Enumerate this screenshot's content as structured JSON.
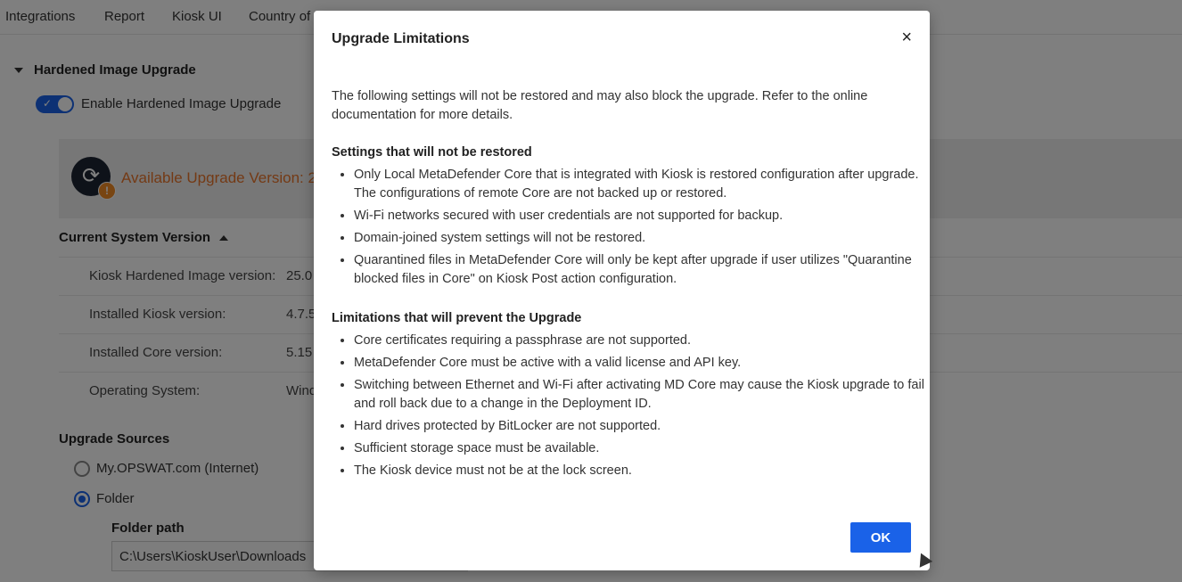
{
  "tabs": [
    "Integrations",
    "Report",
    "Kiosk UI",
    "Country of"
  ],
  "hardened": {
    "title": "Hardened Image Upgrade",
    "enable_label": "Enable Hardened Image Upgrade",
    "available_text": "Available Upgrade Version: 2"
  },
  "current": {
    "title": "Current System Version",
    "rows": [
      {
        "label": "Kiosk Hardened Image version:",
        "value": "25.0"
      },
      {
        "label": "Installed Kiosk version:",
        "value": "4.7.5"
      },
      {
        "label": "Installed Core version:",
        "value": "5.15"
      },
      {
        "label": "Operating System:",
        "value": "Wind"
      }
    ]
  },
  "sources": {
    "title": "Upgrade Sources",
    "options": [
      {
        "label": "My.OPSWAT.com (Internet)",
        "selected": false
      },
      {
        "label": "Folder",
        "selected": true
      }
    ],
    "folder_path_label": "Folder path",
    "folder_path_value": "C:\\Users\\KioskUser\\Downloads"
  },
  "modal": {
    "title": "Upgrade Limitations",
    "close_icon": "×",
    "intro": "The following settings will not be restored and may also block the upgrade. Refer to the online documentation for more details.",
    "section1_title": "Settings that will not be restored",
    "section1_items": [
      "Only Local MetaDefender Core that is integrated with Kiosk is restored configuration after upgrade. The configurations of remote Core are not backed up or restored.",
      "Wi-Fi networks secured with user credentials are not supported for backup.",
      "Domain-joined system settings will not be restored.",
      "Quarantined files in MetaDefender Core will only be kept after upgrade if user utilizes \"Quarantine blocked files in Core\" on Kiosk Post action configuration."
    ],
    "section2_title": "Limitations that will prevent the Upgrade",
    "section2_items": [
      "Core certificates requiring a passphrase are not supported.",
      "MetaDefender Core must be active with a valid license and API key.",
      "Switching between Ethernet and Wi-Fi after activating MD Core may cause the Kiosk upgrade to fail and roll back due to a change in the Deployment ID.",
      "Hard drives protected by BitLocker are not supported.",
      "Sufficient storage space must be available.",
      "The Kiosk device must not be at the lock screen."
    ],
    "ok_label": "OK"
  },
  "colors": {
    "accent": "#1a62e8",
    "warning": "#e8742a",
    "overlay": "rgba(0,0,0,0.5)"
  }
}
